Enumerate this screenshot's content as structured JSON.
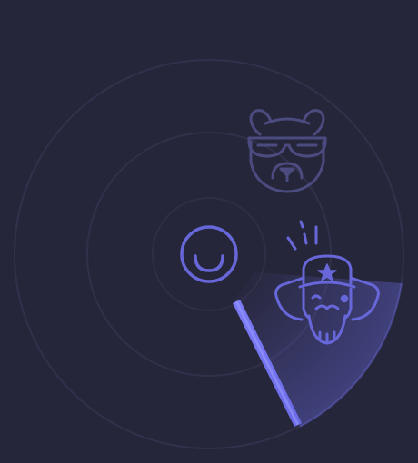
{
  "radar": {
    "colors": {
      "background": "#26263a",
      "ring": "#34344e",
      "accent": "#6a6ae6",
      "accent_bright": "#8a8aff",
      "icon_primary": "#6767d9",
      "icon_muted": "#4b4b80"
    },
    "center_icon": "smile-icon",
    "targets": [
      {
        "icon": "bear-icon",
        "state": "idle"
      },
      {
        "icon": "ushanka-man-icon",
        "state": "detected"
      }
    ]
  }
}
